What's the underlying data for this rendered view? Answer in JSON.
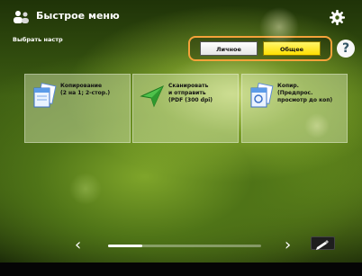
{
  "header": {
    "title": "Быстрое меню",
    "subtitle": "Выбрать настр",
    "app_icon": "people-icon",
    "settings_icon": "gear-icon"
  },
  "mode_switch": {
    "simple_label": "Личное",
    "normal_label": "Общее",
    "selected": "Общее",
    "frame_color": "#f4a23a",
    "selected_color": "#ffeb2a"
  },
  "help": {
    "label": "?",
    "icon": "help-icon"
  },
  "tiles": [
    {
      "label": "Копирование\n(2 на 1; 2-стор.)",
      "icon": "copy-icon"
    },
    {
      "label": "Сканировать\nи отправить\n(PDF (300 dpi)",
      "icon": "scan-send-icon"
    },
    {
      "label": "Копир.\n(Предпрос.\nпросмотр до коп)",
      "icon": "copy-preview-icon"
    }
  ],
  "navigation": {
    "prev_label": "‹",
    "next_label": "›",
    "page_position": 0.0,
    "corner_icon": "edit-arrow-icon"
  }
}
